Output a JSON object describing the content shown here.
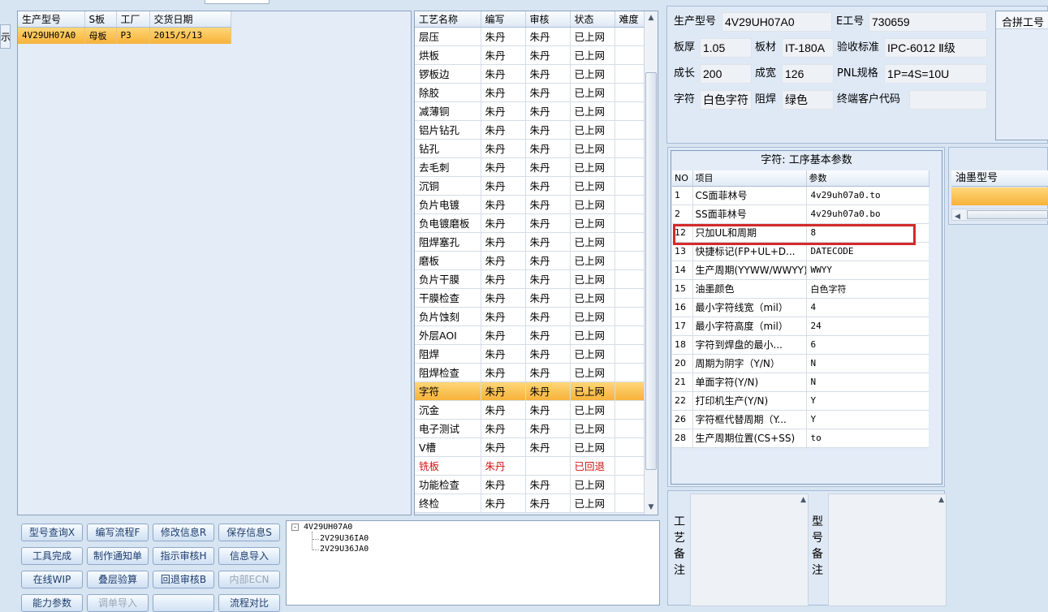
{
  "top_tab_label": "",
  "left_edge_label": "示",
  "model_grid": {
    "headers": [
      "生产型号",
      "S板",
      "工厂",
      "交货日期"
    ],
    "rows": [
      [
        "4V29UH07A0",
        "母板",
        "P3",
        "2015/5/13"
      ]
    ]
  },
  "process_grid": {
    "headers": [
      "工艺名称",
      "编写",
      "审核",
      "状态",
      "难度"
    ],
    "rows": [
      {
        "name": "层压",
        "writer": "朱丹",
        "auditor": "朱丹",
        "status": "已上网",
        "level": "",
        "state": "normal"
      },
      {
        "name": "烘板",
        "writer": "朱丹",
        "auditor": "朱丹",
        "status": "已上网",
        "level": "",
        "state": "normal"
      },
      {
        "name": "锣板边",
        "writer": "朱丹",
        "auditor": "朱丹",
        "status": "已上网",
        "level": "",
        "state": "normal"
      },
      {
        "name": "除胶",
        "writer": "朱丹",
        "auditor": "朱丹",
        "status": "已上网",
        "level": "",
        "state": "normal"
      },
      {
        "name": "减薄铜",
        "writer": "朱丹",
        "auditor": "朱丹",
        "status": "已上网",
        "level": "",
        "state": "normal"
      },
      {
        "name": "铝片钻孔",
        "writer": "朱丹",
        "auditor": "朱丹",
        "status": "已上网",
        "level": "",
        "state": "normal"
      },
      {
        "name": "钻孔",
        "writer": "朱丹",
        "auditor": "朱丹",
        "status": "已上网",
        "level": "",
        "state": "normal"
      },
      {
        "name": "去毛刺",
        "writer": "朱丹",
        "auditor": "朱丹",
        "status": "已上网",
        "level": "",
        "state": "normal"
      },
      {
        "name": "沉铜",
        "writer": "朱丹",
        "auditor": "朱丹",
        "status": "已上网",
        "level": "",
        "state": "normal"
      },
      {
        "name": "负片电镀",
        "writer": "朱丹",
        "auditor": "朱丹",
        "status": "已上网",
        "level": "",
        "state": "normal"
      },
      {
        "name": "负电镀磨板",
        "writer": "朱丹",
        "auditor": "朱丹",
        "status": "已上网",
        "level": "",
        "state": "normal"
      },
      {
        "name": "阻焊塞孔",
        "writer": "朱丹",
        "auditor": "朱丹",
        "status": "已上网",
        "level": "",
        "state": "normal"
      },
      {
        "name": "磨板",
        "writer": "朱丹",
        "auditor": "朱丹",
        "status": "已上网",
        "level": "",
        "state": "normal"
      },
      {
        "name": "负片干膜",
        "writer": "朱丹",
        "auditor": "朱丹",
        "status": "已上网",
        "level": "",
        "state": "normal"
      },
      {
        "name": "干膜检查",
        "writer": "朱丹",
        "auditor": "朱丹",
        "status": "已上网",
        "level": "",
        "state": "normal"
      },
      {
        "name": "负片蚀刻",
        "writer": "朱丹",
        "auditor": "朱丹",
        "status": "已上网",
        "level": "",
        "state": "normal"
      },
      {
        "name": "外层AOI",
        "writer": "朱丹",
        "auditor": "朱丹",
        "status": "已上网",
        "level": "",
        "state": "normal"
      },
      {
        "name": "阻焊",
        "writer": "朱丹",
        "auditor": "朱丹",
        "status": "已上网",
        "level": "",
        "state": "normal"
      },
      {
        "name": "阻焊检查",
        "writer": "朱丹",
        "auditor": "朱丹",
        "status": "已上网",
        "level": "",
        "state": "normal"
      },
      {
        "name": "字符",
        "writer": "朱丹",
        "auditor": "朱丹",
        "status": "已上网",
        "level": "",
        "state": "selected"
      },
      {
        "name": "沉金",
        "writer": "朱丹",
        "auditor": "朱丹",
        "status": "已上网",
        "level": "",
        "state": "normal"
      },
      {
        "name": "电子测试",
        "writer": "朱丹",
        "auditor": "朱丹",
        "status": "已上网",
        "level": "",
        "state": "normal"
      },
      {
        "name": "V槽",
        "writer": "朱丹",
        "auditor": "朱丹",
        "status": "已上网",
        "level": "",
        "state": "normal"
      },
      {
        "name": "铣板",
        "writer": "朱丹",
        "auditor": "",
        "status": "已回退",
        "level": "",
        "state": "returned"
      },
      {
        "name": "功能检查",
        "writer": "朱丹",
        "auditor": "朱丹",
        "status": "已上网",
        "level": "",
        "state": "normal"
      },
      {
        "name": "终检",
        "writer": "朱丹",
        "auditor": "朱丹",
        "status": "已上网",
        "level": "",
        "state": "normal"
      }
    ]
  },
  "info": {
    "model_label": "生产型号",
    "model_value": "4V29UH07A0",
    "e_label": "E工号",
    "e_value": "730659",
    "thickness_label": "板厚",
    "thickness_value": "1.05",
    "material_label": "板材",
    "material_value": "IT-180A",
    "standard_label": "验收标准",
    "standard_value": "IPC-6012 Ⅱ级",
    "length_label": "成长",
    "length_value": "200",
    "width_label": "成宽",
    "width_value": "126",
    "pnl_label": "PNL规格",
    "pnl_value": "1P=4S=10U",
    "char_label": "字符",
    "char_value": "白色字符",
    "mask_label": "阻焊",
    "mask_value": "绿色",
    "customer_label": "终端客户代码",
    "customer_value": "",
    "combine_label": "合拼工号"
  },
  "params": {
    "title": "字符: 工序基本参数",
    "headers": [
      "NO",
      "项目",
      "参数"
    ],
    "rows": [
      {
        "no": "1",
        "item": "CS面菲林号",
        "value": "4v29uh07a0.to"
      },
      {
        "no": "2",
        "item": "SS面菲林号",
        "value": "4v29uh07a0.bo"
      },
      {
        "no": "12",
        "item": "只加UL和周期",
        "value": "8"
      },
      {
        "no": "13",
        "item": "快捷标记(FP+UL+D...",
        "value": "DATECODE"
      },
      {
        "no": "14",
        "item": "生产周期(YYWW/WWYY)",
        "value": "WWYY"
      },
      {
        "no": "15",
        "item": "油墨颜色",
        "value": "白色字符"
      },
      {
        "no": "16",
        "item": "最小字符线宽（mil）",
        "value": "4"
      },
      {
        "no": "17",
        "item": "最小字符高度（mil）",
        "value": "24"
      },
      {
        "no": "18",
        "item": "字符到焊盘的最小...",
        "value": "6"
      },
      {
        "no": "20",
        "item": "周期为阴字（Y/N）",
        "value": "N"
      },
      {
        "no": "21",
        "item": "单面字符(Y/N)",
        "value": "N"
      },
      {
        "no": "22",
        "item": "打印机生产(Y/N)",
        "value": "Y"
      },
      {
        "no": "26",
        "item": "字符框代替周期（Y...",
        "value": "Y"
      },
      {
        "no": "28",
        "item": "生产周期位置(CS+SS)",
        "value": "to"
      }
    ]
  },
  "ink": {
    "header": "油墨型号"
  },
  "buttons": [
    {
      "label": "型号查询X",
      "disabled": false
    },
    {
      "label": "编写流程F",
      "disabled": false
    },
    {
      "label": "修改信息R",
      "disabled": false
    },
    {
      "label": "保存信息S",
      "disabled": false
    },
    {
      "label": "工具完成",
      "disabled": false
    },
    {
      "label": "制作通知单",
      "disabled": false
    },
    {
      "label": "指示审核H",
      "disabled": false
    },
    {
      "label": "信息导入",
      "disabled": false
    },
    {
      "label": "在线WIP",
      "disabled": false
    },
    {
      "label": "叠层验算",
      "disabled": false
    },
    {
      "label": "回退审核B",
      "disabled": false
    },
    {
      "label": "内部ECN",
      "disabled": true
    },
    {
      "label": "能力参数",
      "disabled": false
    },
    {
      "label": "调单导入",
      "disabled": true
    },
    {
      "label": "",
      "disabled": false
    },
    {
      "label": "流程对比",
      "disabled": false
    }
  ],
  "tree": {
    "root": "4V29UH07A0",
    "children": [
      "2V29U36IA0",
      "2V29U36JA0"
    ]
  },
  "process_note_label": "工艺备注",
  "model_note_label": "型号备注"
}
